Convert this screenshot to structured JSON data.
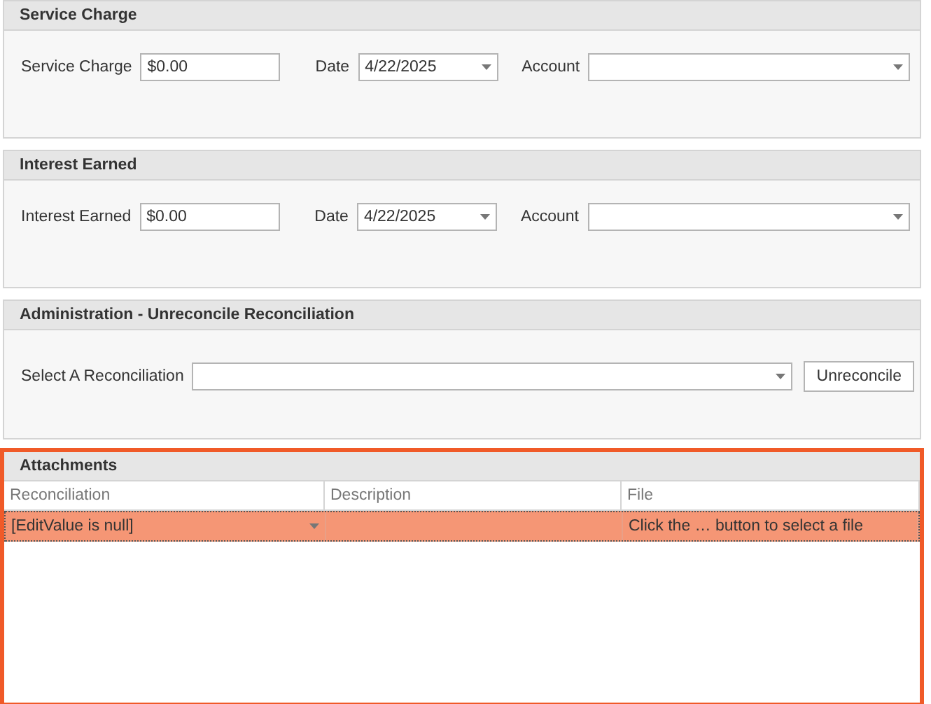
{
  "groups": [
    {
      "title": "Service Charge",
      "fields": [
        {
          "kind": "text",
          "label": "Service Charge",
          "value": "$0.00"
        },
        {
          "kind": "dropdown",
          "label": "Date",
          "value": "4/22/2025"
        },
        {
          "kind": "dropdown",
          "label": "Account"
        }
      ]
    },
    {
      "title": "Interest Earned",
      "fields": [
        {
          "kind": "text",
          "label": "Interest Earned",
          "value": "$0.00"
        },
        {
          "kind": "dropdown",
          "label": "Date",
          "value": "4/22/2025"
        },
        {
          "kind": "dropdown",
          "label": "Account"
        }
      ]
    }
  ],
  "admin": {
    "title": "Administration - Unreconcile Reconciliation",
    "label": "Select A Reconciliation",
    "button": "Unreconcile"
  },
  "attachments": {
    "title": "Attachments",
    "highlighted": true,
    "columns": [
      "Reconciliation",
      "Description",
      "File"
    ],
    "rows": [
      {
        "selected": true,
        "reconciliation": "[EditValue is null]",
        "description": "",
        "file": "Click the … button to select a file"
      }
    ]
  }
}
